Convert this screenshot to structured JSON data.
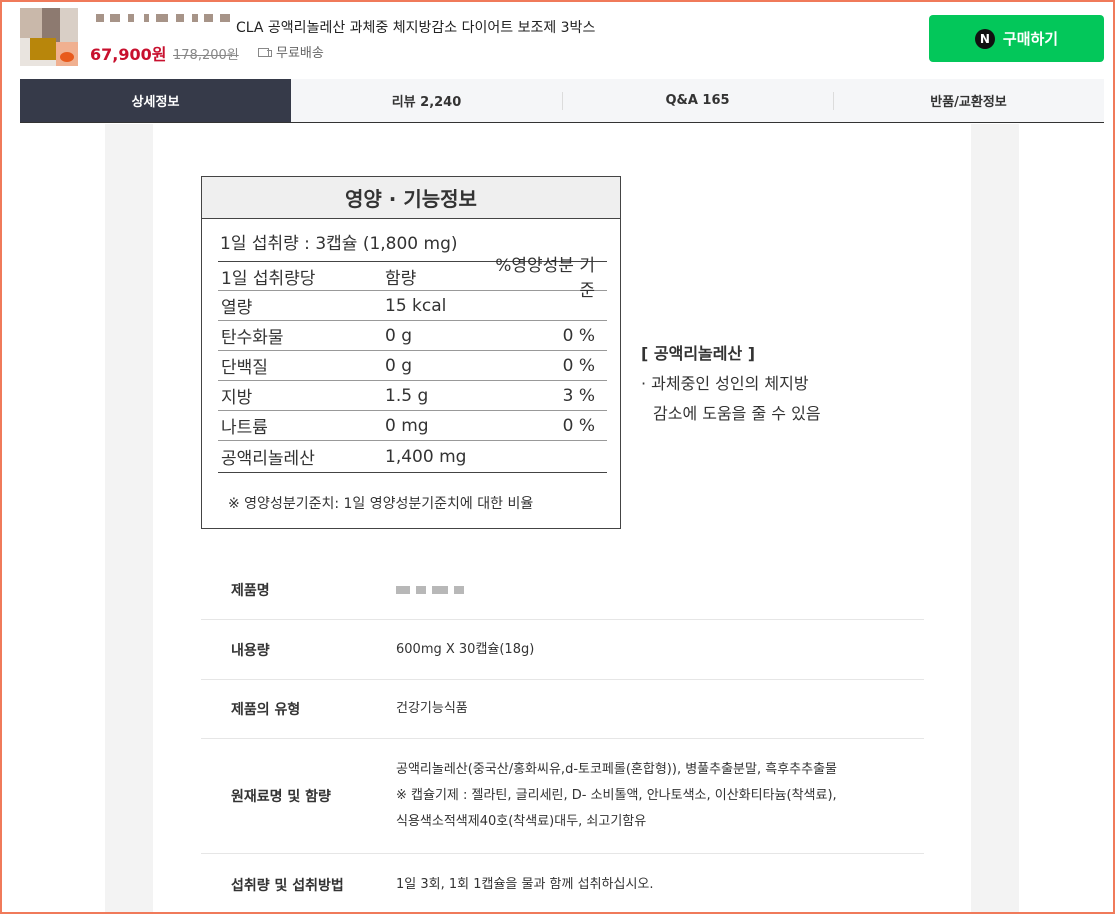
{
  "header": {
    "product_title": "CLA 공액리놀레산 과체중 체지방감소 다이어트 보조제 3박스",
    "price": "67,900원",
    "original_price": "178,200원",
    "shipping": "무료배송",
    "buy_button": "구매하기",
    "buy_button_icon_letter": "N",
    "buy_color": "#03c75a"
  },
  "tabs": [
    {
      "label": "상세정보",
      "active": true
    },
    {
      "label": "리뷰 2,240",
      "active": false
    },
    {
      "label": "Q&A 165",
      "active": false
    },
    {
      "label": "반품/교환정보",
      "active": false
    }
  ],
  "nutrition": {
    "title": "영양 · 기능정보",
    "serving": "1일 섭취량 : 3캡슐 (1,800 mg)",
    "header": [
      "1일 섭취량당",
      "함량",
      "%영양성분 기준"
    ],
    "rows": [
      [
        "열량",
        "15 kcal",
        ""
      ],
      [
        "탄수화물",
        "0 g",
        "0 %"
      ],
      [
        "단백질",
        "0 g",
        "0 %"
      ],
      [
        "지방",
        "1.5 g",
        "3 %"
      ],
      [
        "나트륨",
        "0 mg",
        "0 %"
      ],
      [
        "공액리놀레산",
        "1,400 mg",
        ""
      ]
    ],
    "note": "※ 영양성분기준치: 1일 영양성분기준치에 대한 비율"
  },
  "function_note": {
    "heading": "[ 공액리놀레산 ]",
    "line1": "· 과체중인 성인의 체지방",
    "line2": "감소에 도움을 줄 수 있음"
  },
  "info": [
    {
      "key": "제품명",
      "lines": []
    },
    {
      "key": "내용량",
      "lines": [
        "600mg X 30캡슐(18g)"
      ]
    },
    {
      "key": "제품의 유형",
      "lines": [
        "건강기능식품"
      ]
    },
    {
      "key": "원재료명 및 함량",
      "lines": [
        "공액리놀레산(중국산/홍화씨유,d-토코페롤(혼합형)), 병풀추출분말, 흑후추추출물",
        "※ 캡슐기제 : 젤라틴, 글리세린, D- 소비톨액, 안나토색소, 이산화티타늄(착색료),",
        "식용색소적색제40호(착색료)대두, 쇠고기함유"
      ]
    },
    {
      "key": "섭취량 및 섭취방법",
      "lines": [
        "1일 3회, 1회 1캡슐을 물과 함께 섭취하십시오."
      ]
    }
  ]
}
